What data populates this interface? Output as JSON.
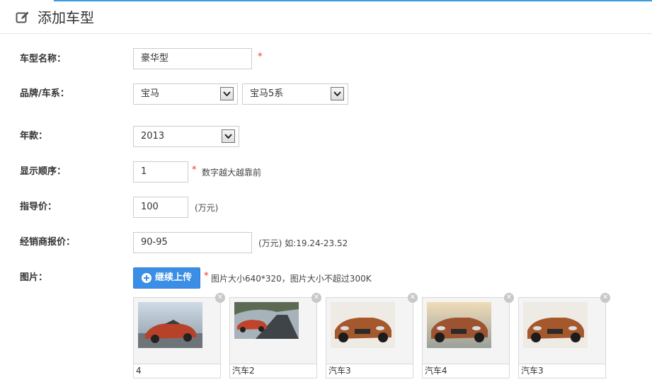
{
  "header": {
    "title": "添加车型",
    "icon": "edit-icon"
  },
  "form": {
    "model_name": {
      "label": "车型名称：",
      "value": "豪华型",
      "required": "*"
    },
    "brand_series": {
      "label": "品牌/车系：",
      "brand": "宝马",
      "series": "宝马5系"
    },
    "year": {
      "label": "年款：",
      "value": "2013"
    },
    "order": {
      "label": "显示顺序：",
      "value": "1",
      "required": "*",
      "hint": "数字越大越靠前"
    },
    "guide_price": {
      "label": "指导价：",
      "value": "100",
      "unit": "(万元)"
    },
    "dealer_price": {
      "label": "经销商报价：",
      "value": "90-95",
      "hint": "(万元) 如:19.24-23.52"
    },
    "images": {
      "label": "图片：",
      "upload_button": "继续上传",
      "required": "*",
      "hint": "图片大小640*320，图片大小不超过300K",
      "items": [
        {
          "caption": "4"
        },
        {
          "caption": "汽车2"
        },
        {
          "caption": "汽车3"
        },
        {
          "caption": "汽车4"
        },
        {
          "caption": "汽车3"
        }
      ]
    }
  },
  "colors": {
    "accent": "#3a8ee6",
    "required": "#e33333",
    "top_line": "#3c9be3"
  }
}
